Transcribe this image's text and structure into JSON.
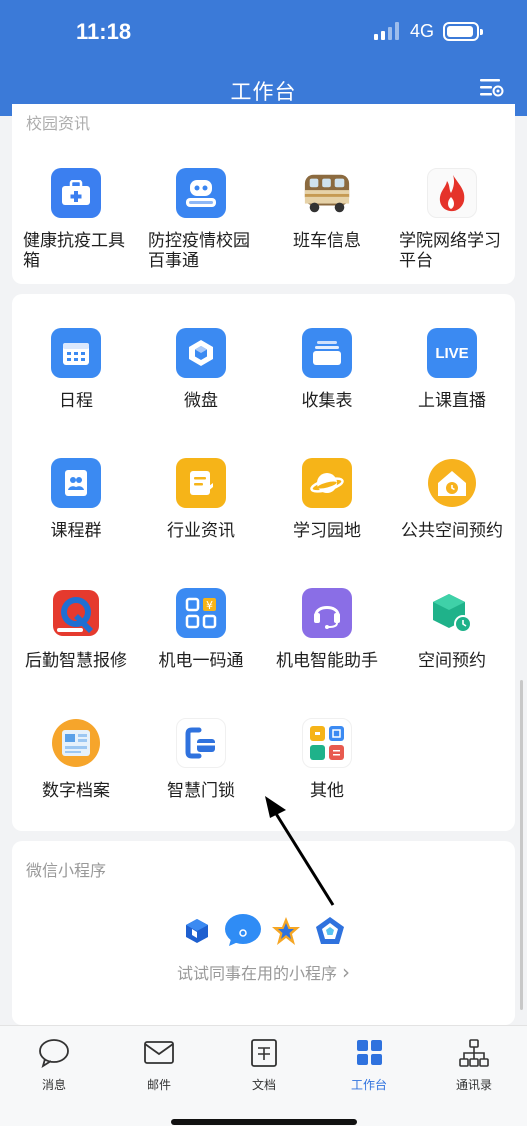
{
  "status_bar": {
    "time": "11:18",
    "network": "4G"
  },
  "header": {
    "title": "工作台",
    "settings_icon": "settings-list-icon"
  },
  "campus_section": {
    "title": "校园资讯",
    "items": [
      {
        "label": "健康抗疫工具箱",
        "icon": "medical-kit-icon"
      },
      {
        "label": "防控疫情校园百事通",
        "icon": "robot-consult-icon"
      },
      {
        "label": "班车信息",
        "icon": "bus-icon"
      },
      {
        "label": "学院网络学习平台",
        "icon": "flame-icon"
      }
    ]
  },
  "tools_section": {
    "items": [
      {
        "label": "日程",
        "icon": "calendar-icon"
      },
      {
        "label": "微盘",
        "icon": "cloud-drive-icon"
      },
      {
        "label": "收集表",
        "icon": "form-icon"
      },
      {
        "label": "上课直播",
        "icon": "live-icon",
        "badge": "LIVE"
      },
      {
        "label": "课程群",
        "icon": "course-group-icon"
      },
      {
        "label": "行业资讯",
        "icon": "news-icon"
      },
      {
        "label": "学习园地",
        "icon": "planet-icon"
      },
      {
        "label": "公共空间预约",
        "icon": "house-clock-icon"
      },
      {
        "label": "后勤智慧报修",
        "icon": "wrench-icon"
      },
      {
        "label": "机电一码通",
        "icon": "qr-code-icon"
      },
      {
        "label": "机电智能助手",
        "icon": "headset-icon"
      },
      {
        "label": "空间预约",
        "icon": "cube-clock-icon"
      },
      {
        "label": "数字档案",
        "icon": "archive-icon"
      },
      {
        "label": "智慧门锁",
        "icon": "door-lock-icon"
      },
      {
        "label": "其他",
        "icon": "apps-grid-icon"
      }
    ]
  },
  "mini_programs": {
    "title": "微信小程序",
    "hint": "试试同事在用的小程序",
    "hint_chevron": "›",
    "icons": [
      "blue-cube-icon",
      "chat-bubble-icon",
      "star-icon",
      "pentagon-icon"
    ]
  },
  "tabbar": {
    "tabs": [
      {
        "label": "消息",
        "icon": "chat-icon"
      },
      {
        "label": "邮件",
        "icon": "mail-icon"
      },
      {
        "label": "文档",
        "icon": "document-icon"
      },
      {
        "label": "工作台",
        "icon": "workbench-icon",
        "active": true
      },
      {
        "label": "通讯录",
        "icon": "org-chart-icon"
      }
    ]
  },
  "colors": {
    "brand": "#3b7ad8",
    "active_tab": "#2f72de",
    "muted": "#999999"
  }
}
